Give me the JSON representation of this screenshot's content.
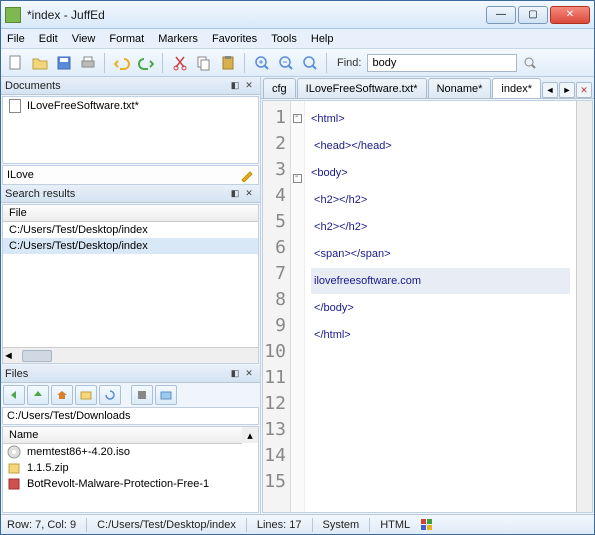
{
  "window": {
    "title": "*index - JuffEd"
  },
  "menu": {
    "file": "File",
    "edit": "Edit",
    "view": "View",
    "format": "Format",
    "markers": "Markers",
    "favorites": "Favorites",
    "tools": "Tools",
    "help": "Help"
  },
  "toolbar": {
    "find_label": "Find:",
    "find_value": "body"
  },
  "panels": {
    "documents": {
      "title": "Documents",
      "items": [
        "ILoveFreeSoftware.txt*"
      ],
      "filter_value": "ILove"
    },
    "search": {
      "title": "Search results",
      "column": "File",
      "rows": [
        "C:/Users/Test/Desktop/index",
        "C:/Users/Test/Desktop/index"
      ]
    },
    "files": {
      "title": "Files",
      "path": "C:/Users/Test/Downloads",
      "column": "Name",
      "rows": [
        "memtest86+-4.20.iso",
        "1.1.5.zip",
        "BotRevolt-Malware-Protection-Free-1"
      ]
    }
  },
  "tabs": {
    "t0": "cfg",
    "t1": "ILoveFreeSoftware.txt*",
    "t2": "Noname*",
    "t3": "index*"
  },
  "code": {
    "l1": "<html>",
    "l2": " <head></head>",
    "l3": "<body>",
    "l4": " <h2></h2>",
    "l5": " <h2></h2>",
    "l6": " <span></span>",
    "l7": " ilovefreesoftware.com",
    "l8": " </body>",
    "l9": " </html>"
  },
  "status": {
    "pos": "Row: 7, Col: 9",
    "path": "C:/Users/Test/Desktop/index",
    "lines": "Lines: 17",
    "sys": "System",
    "lang": "HTML"
  }
}
